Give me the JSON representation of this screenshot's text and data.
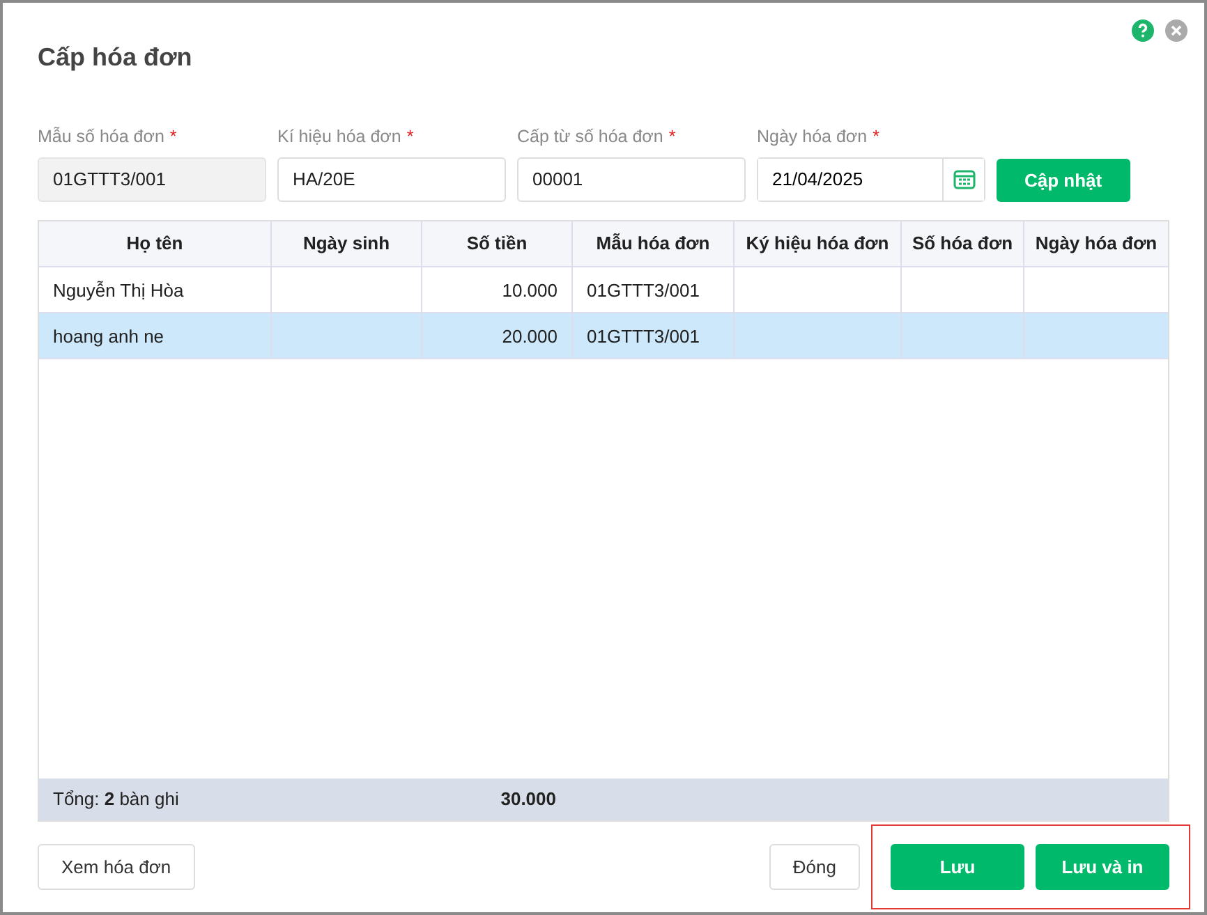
{
  "dialog": {
    "title": "Cấp hóa đơn"
  },
  "fields": [
    {
      "label": "Mẫu số hóa đơn",
      "required_mark": "*",
      "value": "01GTTT3/001",
      "disabled": true,
      "kind": "text"
    },
    {
      "label": "Kí hiệu hóa đơn",
      "required_mark": "*",
      "value": "HA/20E",
      "disabled": false,
      "kind": "text"
    },
    {
      "label": "Cấp từ số hóa đơn",
      "required_mark": "*",
      "value": "00001",
      "disabled": false,
      "kind": "text"
    },
    {
      "label": "Ngày hóa đơn",
      "required_mark": "*",
      "value": "21/04/2025",
      "disabled": false,
      "kind": "date"
    }
  ],
  "update_button": "Cập nhật",
  "table": {
    "columns": [
      "Họ tên",
      "Ngày sinh",
      "Số tiền",
      "Mẫu hóa đơn",
      "Ký hiệu hóa đơn",
      "Số hóa đơn",
      "Ngày hóa đơn"
    ],
    "rows": [
      {
        "selected": false,
        "cells": [
          "Nguyễn Thị Hòa",
          "",
          "10.000",
          "01GTTT3/001",
          "",
          "",
          ""
        ]
      },
      {
        "selected": true,
        "cells": [
          "hoang anh ne",
          "",
          "20.000",
          "01GTTT3/001",
          "",
          "",
          ""
        ]
      }
    ],
    "summary": {
      "label": "Tổng: **2** bàn ghi",
      "total": "30.000"
    }
  },
  "footer_buttons": [
    {
      "label": "Xem hóa đơn",
      "kind": "outline",
      "highlighted": false
    },
    {
      "label": "Đóng",
      "kind": "outline",
      "highlighted": false
    },
    {
      "label": "Lưu",
      "kind": "primary",
      "highlighted": true
    },
    {
      "label": "Lưu và in",
      "kind": "primary",
      "highlighted": true
    }
  ]
}
